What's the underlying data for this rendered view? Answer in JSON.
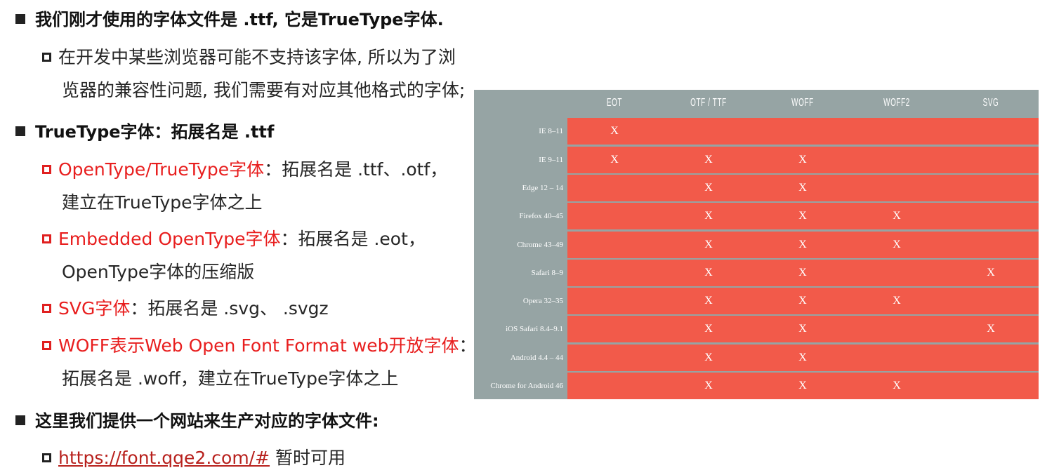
{
  "bullets": {
    "b1": "我们刚才使用的字体文件是 .ttf, 它是TrueType字体.",
    "b1_sub1_line1": "在开发中某些浏览器可能不支持该字体, 所以为了浏",
    "b1_sub1_line2": "览器的兼容性问题, 我们需要有对应其他格式的字体;",
    "b2": "TrueType字体：拓展名是 .ttf",
    "b2_sub1_red": "OpenType/TrueType字体",
    "b2_sub1_rest": "：拓展名是 .ttf、.otf，",
    "b2_sub1_line2": "建立在TrueType字体之上",
    "b2_sub2_red": "Embedded OpenType字体",
    "b2_sub2_rest": "：拓展名是 .eot，",
    "b2_sub2_line2": "OpenType字体的压缩版",
    "b2_sub3_red": "SVG字体",
    "b2_sub3_rest": "：拓展名是 .svg、 .svgz",
    "b2_sub4_red": "WOFF表示Web Open Font Format web开放字体",
    "b2_sub4_rest": "：",
    "b2_sub4_line2": "拓展名是 .woff，建立在TrueType字体之上",
    "b3": "这里我们提供一个网站来生产对应的字体文件:",
    "b3_sub1_link": "https://font.qqe2.com/#",
    "b3_sub1_rest": " 暂时可用"
  },
  "compat_table": {
    "colors": {
      "label_bg": "#96a4a4",
      "cell_bg": "#f25a4a",
      "text": "#ffffff"
    },
    "columns": [
      "EOT",
      "OTF / TTF",
      "WOFF",
      "WOFF2",
      "SVG"
    ],
    "rows": [
      {
        "browser": "IE 8–11",
        "marks": [
          "X",
          "",
          "",
          "",
          ""
        ]
      },
      {
        "browser": "IE 9–11",
        "marks": [
          "X",
          "X",
          "X",
          "",
          ""
        ]
      },
      {
        "browser": "Edge 12 – 14",
        "marks": [
          "",
          "X",
          "X",
          "",
          ""
        ]
      },
      {
        "browser": "Firefox 40–45",
        "marks": [
          "",
          "X",
          "X",
          "X",
          ""
        ]
      },
      {
        "browser": "Chrome 43–49",
        "marks": [
          "",
          "X",
          "X",
          "X",
          ""
        ]
      },
      {
        "browser": "Safari 8–9",
        "marks": [
          "",
          "X",
          "X",
          "",
          "X"
        ]
      },
      {
        "browser": "Opera 32–35",
        "marks": [
          "",
          "X",
          "X",
          "X",
          ""
        ]
      },
      {
        "browser": "iOS Safari 8.4–9.1",
        "marks": [
          "",
          "X",
          "X",
          "",
          "X"
        ]
      },
      {
        "browser": "Android 4.4 – 44",
        "marks": [
          "",
          "X",
          "X",
          "",
          ""
        ]
      },
      {
        "browser": "Chrome for Android 46",
        "marks": [
          "",
          "X",
          "X",
          "X",
          ""
        ]
      }
    ]
  }
}
